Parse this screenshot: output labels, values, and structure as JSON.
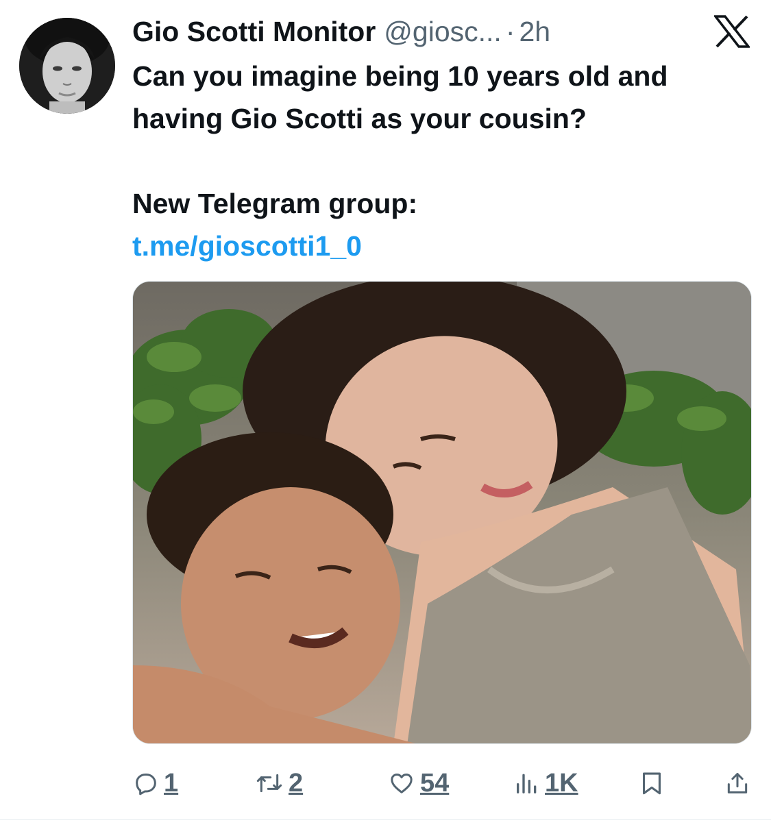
{
  "tweet": {
    "author_name": "Gio Scotti Monitor",
    "handle": "@giosc...",
    "separator": "·",
    "time": "2h",
    "text_line1": "Can you imagine being 10 years old and having Gio Scotti as your cousin?",
    "text_line2": "New Telegram group:",
    "link": "t.me/gioscotti1_0",
    "media_icon": "photo",
    "avatar_icon": "profile-photo"
  },
  "actions": {
    "replies": "1",
    "reposts": "2",
    "likes": "54",
    "views": "1K",
    "icons": [
      "reply-icon",
      "repost-icon",
      "like-icon",
      "views-icon",
      "bookmark-icon",
      "share-icon"
    ]
  },
  "colors": {
    "text": "#0f1419",
    "secondary": "#536471",
    "link": "#1d9bf0"
  }
}
